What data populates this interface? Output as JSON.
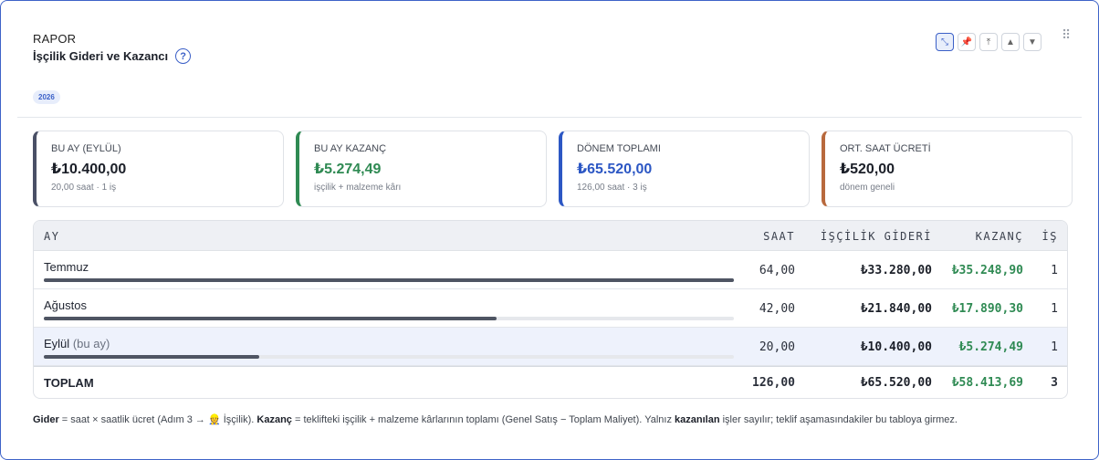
{
  "header": {
    "kicker": "RAPOR",
    "title": "İşçilik Gideri ve Kazancı",
    "help": "?",
    "year_badge": "2026"
  },
  "toolbar": {
    "icons": [
      "expand-icon",
      "pin-icon",
      "move-top-icon",
      "move-up-icon",
      "move-down-icon",
      "drag-handle-icon"
    ],
    "expand": "⤡",
    "pin": "📌",
    "top": "⤒",
    "up": "▲",
    "down": "▼",
    "grip": "⠿"
  },
  "stats": [
    {
      "label": "BU AY (Eylül)",
      "value": "₺10.400,00",
      "sub": "20,00 saat · 1 iş",
      "color": "#4a5066"
    },
    {
      "label": "BU AY KAZANÇ",
      "value": "₺5.274,49",
      "sub": "işçilik + malzeme kârı",
      "color": "#2f8a53"
    },
    {
      "label": "DÖNEM TOPLAMI",
      "value": "₺65.520,00",
      "sub": "126,00 saat · 3 iş",
      "color": "#2c57c4"
    },
    {
      "label": "ORT. SAAT ÜCRETİ",
      "value": "₺520,00",
      "sub": "dönem geneli",
      "color": "#b8693d"
    }
  ],
  "table": {
    "columns": {
      "month": "AY",
      "hours": "SAAT",
      "cost": "İŞÇİLİK GİDERİ",
      "profit": "KAZANÇ",
      "jobs": "İŞ"
    },
    "rows": [
      {
        "month": "Temmuz",
        "note": "",
        "hours": "64,00",
        "cost": "₺33.280,00",
        "profit": "₺35.248,90",
        "jobs": "1",
        "bar_fraction": 1.0
      },
      {
        "month": "Ağustos",
        "note": "",
        "hours": "42,00",
        "cost": "₺21.840,00",
        "profit": "₺17.890,30",
        "jobs": "1",
        "bar_fraction": 0.656
      },
      {
        "month": "Eylül",
        "note": "(bu ay)",
        "hours": "20,00",
        "cost": "₺10.400,00",
        "profit": "₺5.274,49",
        "jobs": "1",
        "bar_fraction": 0.3125
      }
    ],
    "total": {
      "label": "TOPLAM",
      "hours": "126,00",
      "cost": "₺65.520,00",
      "profit": "₺58.413,69",
      "jobs": "3"
    }
  },
  "footer": {
    "gider_term": "Gider",
    "gider_text": " = saat × saatlik ücret (Adım 3 → 👷 İşçilik). ",
    "kazanc_term": "Kazanç",
    "kazanc_text": " = teklifteki işçilik + malzeme kârlarının toplamı (Genel Satış − Toplam Maliyet). Yalnız ",
    "won_term": "kazanılan",
    "won_text": " işler sayılır; teklif aşamasındakiler bu tabloya girmez."
  }
}
